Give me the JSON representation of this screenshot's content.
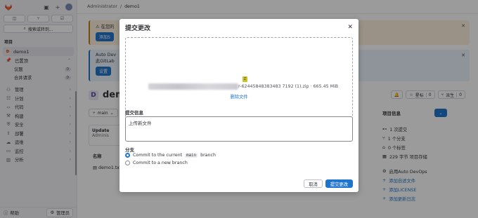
{
  "sidebar": {
    "search_label": "搜索或转到...",
    "section_label": "项目",
    "project_name": "demo1",
    "project_badge": "D",
    "items": [
      {
        "label": "已置顶"
      },
      {
        "label": "议题",
        "count": "0",
        "sub": true
      },
      {
        "label": "合并请求",
        "count": "0",
        "sub": true
      },
      {
        "label": "管理"
      },
      {
        "label": "计划"
      },
      {
        "label": "代码"
      },
      {
        "label": "构建"
      },
      {
        "label": "安全"
      },
      {
        "label": "部署"
      },
      {
        "label": "运维"
      },
      {
        "label": "监控"
      },
      {
        "label": "分析"
      }
    ],
    "help_label": "帮助",
    "admin_label": "管理员"
  },
  "breadcrumb": {
    "parent": "Administrator",
    "separator": "/",
    "current": "demo1"
  },
  "alerts": {
    "warn_text": "在您的",
    "warn_button": "添加S",
    "info_line1": "Auto Dev",
    "info_line2": "此GitLab",
    "info_button": "设置"
  },
  "project": {
    "title": "dem",
    "badge": "D",
    "star_label": "星标",
    "star_count": "0",
    "fork_label": "派生",
    "fork_count": "0",
    "branch": "main",
    "commit_title": "Update",
    "commit_author": "Adminis",
    "files_header": "名称",
    "file_name": "demo1.txt"
  },
  "project_info": {
    "title": "项目信息",
    "items": [
      {
        "label": "1 次提交"
      },
      {
        "label": "1 个分支"
      },
      {
        "label": "0 个标签"
      },
      {
        "label": "229 字节 项目存储"
      }
    ],
    "links": [
      {
        "label": "启用Auto DevOps",
        "link": false
      },
      {
        "label": "添加自述文件",
        "link": true
      },
      {
        "label": "添加LICENSE",
        "link": true
      },
      {
        "label": "添加更新日志",
        "link": true
      }
    ]
  },
  "modal": {
    "title": "提交更改",
    "file_icon_letter": "Z",
    "file_name_suffix": "r-62445848383483 7192 (1).zip · 665.45 MiB",
    "remove_file": "删除文件",
    "commit_message_label": "提交信息",
    "commit_message_value": "上传新文件",
    "branch_label": "分支",
    "option_current_prefix": "Commit to the current",
    "option_current_branch": "main",
    "option_current_suffix": "branch",
    "option_new": "Commit to a new branch",
    "cancel": "取消",
    "submit": "提交更改"
  }
}
